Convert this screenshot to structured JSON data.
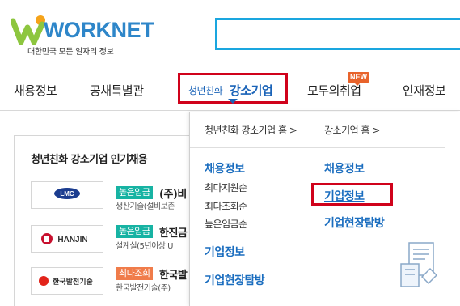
{
  "header": {
    "logo_text": "WORKNET",
    "tagline": "대한민국 모든 일자리 정보"
  },
  "nav": {
    "items": [
      {
        "label": "채용정보"
      },
      {
        "label": "공채특별관"
      },
      {
        "label_small": "청년친화",
        "label_big": "강소기업"
      },
      {
        "label": "모두의취업",
        "badge": "NEW"
      },
      {
        "label": "인재정보"
      }
    ]
  },
  "left": {
    "title": "청년친화 강소기업 인기채용",
    "rows": [
      {
        "logo": "LMC",
        "tag": "높은임금",
        "tag_color": "green",
        "name": "(주)비",
        "sub": "생산기술(설비보존"
      },
      {
        "logo": "HANJIN",
        "tag": "높은임금",
        "tag_color": "green",
        "name": "한진금",
        "sub": "설계실(5년이상 U"
      },
      {
        "logo": "한국발전기술",
        "tag": "최다조회",
        "tag_color": "orange",
        "name": "한국발",
        "sub": "한국발전기술(주)"
      }
    ]
  },
  "dropdown": {
    "top_links": [
      "청년친화 강소기업 홈 >",
      "강소기업 홈 >"
    ],
    "col1": {
      "title": "채용정보",
      "subs": [
        "최다지원순",
        "최다조회순",
        "높은임금순"
      ],
      "extra": [
        "기업정보",
        "기업현장탐방"
      ]
    },
    "col2": {
      "items": [
        "채용정보",
        "기업정보",
        "기업현장탐방"
      ]
    }
  },
  "colors": {
    "brand_blue": "#1a63b8",
    "highlight_red": "#d0021b",
    "search_border": "#1aa6df",
    "tag_green": "#17b3a3",
    "tag_orange": "#f07c4a",
    "new_badge": "#e8632b"
  }
}
